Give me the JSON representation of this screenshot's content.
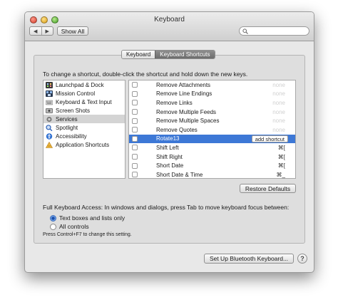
{
  "window": {
    "title": "Keyboard"
  },
  "toolbar": {
    "show_all_label": "Show All",
    "back_glyph": "◀",
    "forward_glyph": "▶"
  },
  "tabs": [
    {
      "label": "Keyboard",
      "active": false
    },
    {
      "label": "Keyboard Shortcuts",
      "active": true
    }
  ],
  "instructions": "To change a shortcut, double-click the shortcut and hold down the new keys.",
  "categories": [
    {
      "label": "Launchpad & Dock",
      "icon": "launchpad-icon"
    },
    {
      "label": "Mission Control",
      "icon": "mission-control-icon"
    },
    {
      "label": "Keyboard & Text Input",
      "icon": "keyboard-icon"
    },
    {
      "label": "Screen Shots",
      "icon": "screenshot-icon"
    },
    {
      "label": "Services",
      "icon": "gear-icon",
      "selected": true
    },
    {
      "label": "Spotlight",
      "icon": "spotlight-icon"
    },
    {
      "label": "Accessibility",
      "icon": "accessibility-icon"
    },
    {
      "label": "Application Shortcuts",
      "icon": "app-shortcuts-icon"
    }
  ],
  "shortcuts": [
    {
      "label": "Remove Attachments",
      "key": "none",
      "faint": true
    },
    {
      "label": "Remove Line Endings",
      "key": "none",
      "faint": true
    },
    {
      "label": "Remove Links",
      "key": "none",
      "faint": true
    },
    {
      "label": "Remove Multiple Feeds",
      "key": "none",
      "faint": true
    },
    {
      "label": "Remove Multiple Spaces",
      "key": "none",
      "faint": true
    },
    {
      "label": "Remove Quotes",
      "key": "none",
      "faint": true
    },
    {
      "label": "Rotate13",
      "button": "add shortcut",
      "selected": true
    },
    {
      "label": "Shift Left",
      "key": "⌘["
    },
    {
      "label": "Shift Right",
      "key": "⌘["
    },
    {
      "label": "Short Date",
      "key": "⌘["
    },
    {
      "label": "Short Date & Time",
      "key": "⌘_"
    }
  ],
  "restore_defaults_label": "Restore Defaults",
  "full_keyboard_access": {
    "label": "Full Keyboard Access: In windows and dialogs, press Tab to move keyboard focus between:",
    "options": [
      {
        "label": "Text boxes and lists only",
        "selected": true
      },
      {
        "label": "All controls",
        "selected": false
      }
    ],
    "hint": "Press Control+F7 to change this setting."
  },
  "bluetooth_button_label": "Set Up Bluetooth Keyboard...",
  "help_label": "?"
}
